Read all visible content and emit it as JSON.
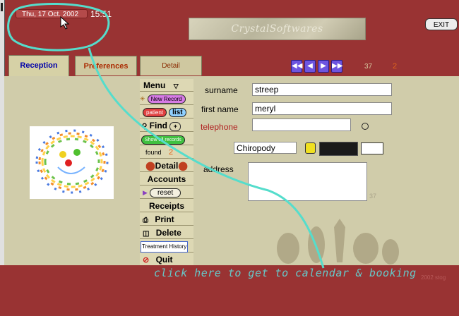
{
  "header": {
    "date": "Thu, 17 Oct. 2002",
    "time": "15:51",
    "logo_text": "CrystalSoftwares",
    "exit_label": "EXIT"
  },
  "tabs": [
    {
      "label": "Reception",
      "active": true
    },
    {
      "label": "Preferences",
      "active": false
    },
    {
      "label": "Detail",
      "active": false
    }
  ],
  "nav": {
    "record_total": "37",
    "record_current": "2"
  },
  "menu": {
    "title": "Menu",
    "new_record": "New Record",
    "patient": "patient",
    "list": "list",
    "find": "Find",
    "show_all": "Show all records",
    "found_label": "found",
    "found_count": "2",
    "detail": "Detail",
    "accounts": "Accounts",
    "reset": "reset",
    "receipts": "Receipts",
    "print": "Print",
    "delete": "Delete",
    "treatment_history": "Treatment History",
    "quit": "Quit"
  },
  "form": {
    "surname_label": "surname",
    "surname_value": "streep",
    "firstname_label": "first name",
    "firstname_value": "meryl",
    "telephone_label": "telephone",
    "telephone_value": "",
    "category_value": "Chiropody",
    "address_label": "address",
    "address_value": "",
    "address_count": "37"
  },
  "annotation": {
    "hint_text": "click here to get to calendar & booking"
  },
  "footer": {
    "copyright": "2002 stog"
  },
  "colors": {
    "background": "#993333",
    "panel": "#d0ccaa",
    "annotation": "#55ddcc"
  }
}
